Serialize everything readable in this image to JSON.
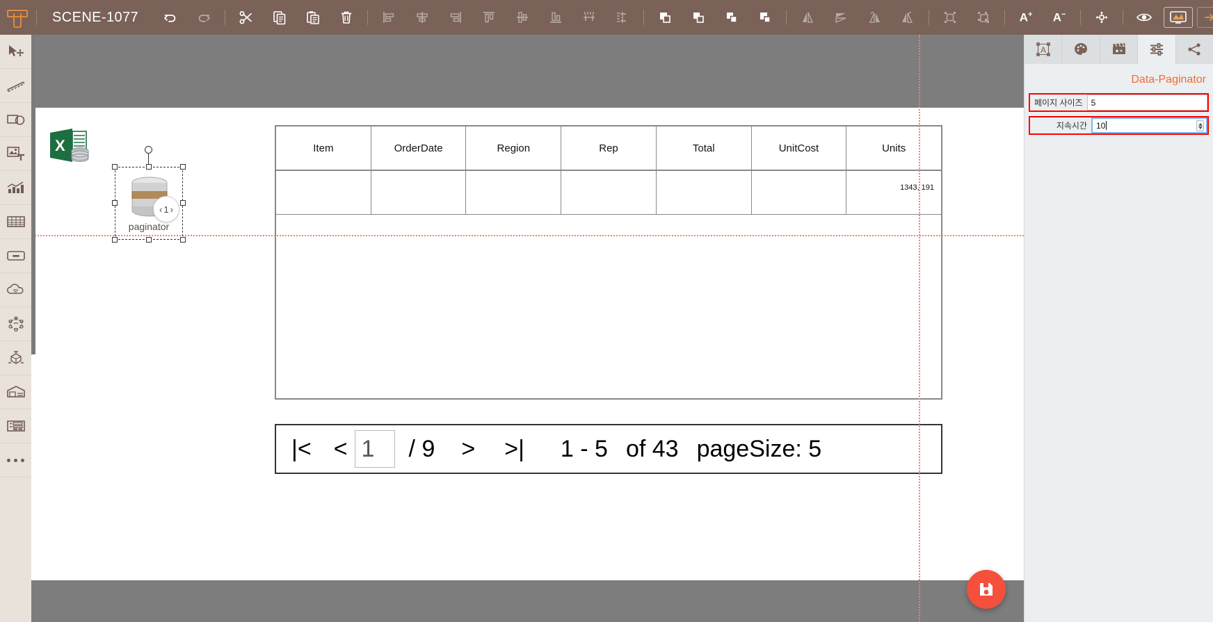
{
  "app": {
    "logo": "t-logo-icon",
    "scene_title": "SCENE-1077"
  },
  "toolbar": {
    "items": [
      {
        "name": "undo-button",
        "icon": "undo-icon",
        "disabled": false
      },
      {
        "name": "redo-button",
        "icon": "redo-icon",
        "disabled": true
      },
      {
        "name": "cut-button",
        "icon": "scissors-icon",
        "disabled": false
      },
      {
        "name": "copy-button",
        "icon": "copy-icon",
        "disabled": false
      },
      {
        "name": "paste-button",
        "icon": "paste-icon",
        "disabled": false
      },
      {
        "name": "delete-button",
        "icon": "trash-icon",
        "disabled": false
      },
      {
        "name": "align-left-button",
        "icon": "align-left-icon",
        "disabled": true
      },
      {
        "name": "align-center-button",
        "icon": "align-center-icon",
        "disabled": true
      },
      {
        "name": "align-right-button",
        "icon": "align-right-icon",
        "disabled": true
      },
      {
        "name": "align-top-button",
        "icon": "align-top-icon",
        "disabled": true
      },
      {
        "name": "align-middle-button",
        "icon": "align-middle-icon",
        "disabled": true
      },
      {
        "name": "align-bottom-button",
        "icon": "align-bottom-icon",
        "disabled": true
      },
      {
        "name": "distribute-h-button",
        "icon": "distribute-horizontal-icon",
        "disabled": true
      },
      {
        "name": "distribute-v-button",
        "icon": "distribute-vertical-icon",
        "disabled": true
      },
      {
        "name": "bring-to-front-button",
        "icon": "bring-to-front-icon",
        "disabled": false
      },
      {
        "name": "bring-forward-button",
        "icon": "bring-forward-icon",
        "disabled": false
      },
      {
        "name": "send-backward-button",
        "icon": "send-backward-icon",
        "disabled": false
      },
      {
        "name": "send-to-back-button",
        "icon": "send-to-back-icon",
        "disabled": false
      },
      {
        "name": "flip-horizontal-button",
        "icon": "flip-horizontal-icon",
        "disabled": true
      },
      {
        "name": "flip-vertical-button",
        "icon": "flip-vertical-icon",
        "disabled": true
      },
      {
        "name": "rotate-left-button",
        "icon": "rotate-left-icon",
        "disabled": true
      },
      {
        "name": "rotate-right-button",
        "icon": "rotate-right-icon",
        "disabled": true
      },
      {
        "name": "group-button",
        "icon": "group-icon",
        "disabled": true
      },
      {
        "name": "ungroup-button",
        "icon": "ungroup-icon",
        "disabled": true
      }
    ],
    "font_increase_label": "A",
    "font_increase_sup": "+",
    "font_decrease_label": "A",
    "font_decrease_sup": "−",
    "fit_button": "fit-to-screen-icon",
    "preview_button": "eye-icon",
    "fullscreen_button": "monitor-icon",
    "collapse_panel_button": "collapse-right-panel-icon"
  },
  "sidebar": {
    "items": [
      {
        "name": "sidebar-item-select",
        "icon": "cursor-move-icon"
      },
      {
        "name": "sidebar-item-line",
        "icon": "dashed-line-icon"
      },
      {
        "name": "sidebar-item-shapes",
        "icon": "shapes-icon"
      },
      {
        "name": "sidebar-item-media",
        "icon": "image-text-icon"
      },
      {
        "name": "sidebar-item-chart",
        "icon": "bar-chart-icon"
      },
      {
        "name": "sidebar-item-table",
        "icon": "table-grid-icon"
      },
      {
        "name": "sidebar-item-container",
        "icon": "container-box-icon"
      },
      {
        "name": "sidebar-item-cloud",
        "icon": "cloud-wifi-icon"
      },
      {
        "name": "sidebar-item-network",
        "icon": "network-nodes-icon"
      },
      {
        "name": "sidebar-item-3d",
        "icon": "cube-3d-icon"
      },
      {
        "name": "sidebar-item-warehouse",
        "icon": "warehouse-icon"
      },
      {
        "name": "sidebar-item-form",
        "icon": "form-layout-icon"
      },
      {
        "name": "sidebar-item-more",
        "icon": "more-dots-icon"
      }
    ]
  },
  "canvas": {
    "excel_source": {
      "name": "excel-data-source-icon",
      "label": "excel-db-icon"
    },
    "paginator_node": {
      "label": "paginator",
      "badge_prev": "‹",
      "badge_value": "1",
      "badge_next": "›",
      "icon": "database-cylinder-icon"
    },
    "table": {
      "columns": [
        "Item",
        "OrderDate",
        "Region",
        "Rep",
        "Total",
        "UnitCost",
        "Units"
      ],
      "rows": [
        {
          "Item": "",
          "OrderDate": "",
          "Region": "",
          "Rep": "",
          "Total": "",
          "UnitCost": "",
          "Units": "1343, 191"
        }
      ]
    },
    "pager": {
      "first_label": "|<",
      "prev_label": "<",
      "page_value": "1",
      "total_pages_label": "/ 9",
      "next_label": ">",
      "last_label": ">|",
      "range_label": "1  -  5",
      "of_label": "of 43",
      "page_size_label": "pageSize: 5"
    },
    "save_fab": {
      "name": "save-fab-button",
      "icon": "floppy-save-icon",
      "color": "#f4503c"
    }
  },
  "right_panel": {
    "tabs": [
      {
        "name": "tab-transform",
        "icon": "text-frame-icon",
        "active": false
      },
      {
        "name": "tab-style",
        "icon": "palette-icon",
        "active": false
      },
      {
        "name": "tab-animation",
        "icon": "clapperboard-icon",
        "active": false
      },
      {
        "name": "tab-properties",
        "icon": "sliders-icon",
        "active": true
      },
      {
        "name": "tab-share",
        "icon": "share-icon",
        "active": false
      }
    ],
    "title": "Data-Paginator",
    "fields": [
      {
        "name": "page-size-field",
        "label": "페이지 사이즈",
        "value": "5",
        "focused": false,
        "spinner": false
      },
      {
        "name": "duration-field",
        "label": "지속시간",
        "value": "10",
        "focused": true,
        "spinner": true
      }
    ]
  },
  "colors": {
    "topbar": "#7a6258",
    "sidebar": "#e9e2da",
    "canvas_bg": "#7d7d7d",
    "accent": "#e08a3c",
    "panel_title": "#ef6a33",
    "annotation": "#ff0000",
    "guide": "#f08070",
    "fab": "#f4503c"
  }
}
